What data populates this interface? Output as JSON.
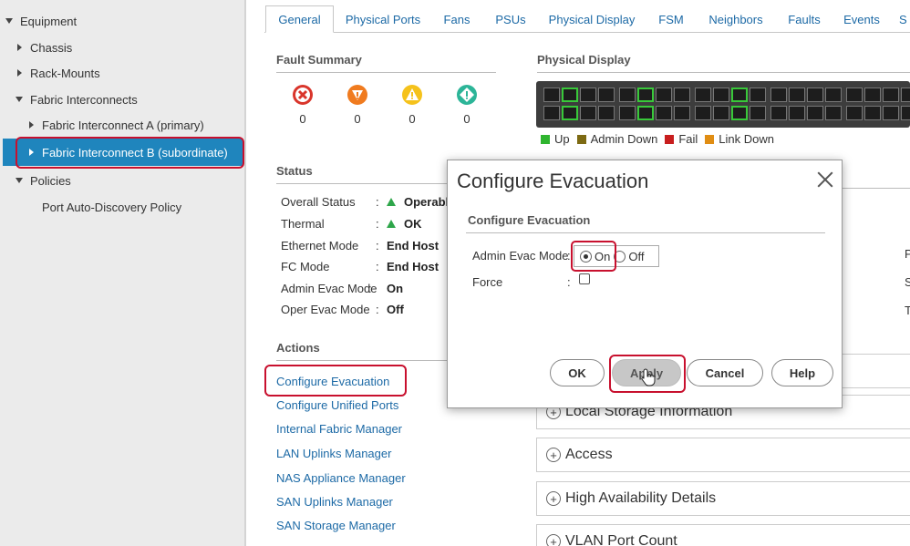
{
  "sidebar": {
    "items": [
      {
        "label": "Equipment",
        "level": 0,
        "expander": "down"
      },
      {
        "label": "Chassis",
        "level": 1,
        "expander": "right"
      },
      {
        "label": "Rack-Mounts",
        "level": 1,
        "expander": "right"
      },
      {
        "label": "Fabric Interconnects",
        "level": 1,
        "expander": "down"
      },
      {
        "label": "Fabric Interconnect A (primary)",
        "level": 2,
        "expander": "right"
      },
      {
        "label": "Fabric Interconnect B (subordinate)",
        "level": 2,
        "expander": "right",
        "selected": true
      },
      {
        "label": "Policies",
        "level": 1,
        "expander": "down"
      },
      {
        "label": "Port Auto-Discovery Policy",
        "level": 2,
        "expander": "none"
      }
    ]
  },
  "tabs": [
    "General",
    "Physical Ports",
    "Fans",
    "PSUs",
    "Physical Display",
    "FSM",
    "Neighbors",
    "Faults",
    "Events",
    "S"
  ],
  "active_tab": "General",
  "fault_summary": {
    "title": "Fault Summary",
    "items": [
      {
        "icon": "critical-fault-icon",
        "count": "0",
        "color": "#d9352b"
      },
      {
        "icon": "major-fault-icon",
        "count": "0",
        "color": "#f07b1f"
      },
      {
        "icon": "minor-fault-icon",
        "count": "0",
        "color": "#f5c21b"
      },
      {
        "icon": "warning-fault-icon",
        "count": "0",
        "color": "#2cb598"
      }
    ]
  },
  "status": {
    "title": "Status",
    "rows": [
      {
        "label": "Overall Status",
        "value": "Operable",
        "icon": "up-arrow-icon"
      },
      {
        "label": "Thermal",
        "value": "OK",
        "icon": "up-arrow-icon"
      },
      {
        "label": "Ethernet Mode",
        "value": "End Host"
      },
      {
        "label": "FC Mode",
        "value": "End Host"
      },
      {
        "label": "Admin Evac Mode",
        "value": "On"
      },
      {
        "label": "Oper Evac Mode",
        "value": "Off"
      }
    ]
  },
  "actions": {
    "title": "Actions",
    "links": [
      "Configure Evacuation",
      "Configure Unified Ports",
      "Internal Fabric Manager",
      "LAN Uplinks Manager",
      "NAS Appliance Manager",
      "SAN Uplinks Manager",
      "SAN Storage Manager"
    ]
  },
  "physical_display": {
    "title": "Physical Display",
    "legend": [
      {
        "label": "Up",
        "color": "#2fb52f"
      },
      {
        "label": "Admin Down",
        "color": "#7d6a13"
      },
      {
        "label": "Fail",
        "color": "#c81e1e"
      },
      {
        "label": "Link Down",
        "color": "#e08d13"
      }
    ]
  },
  "panels": [
    "Local Storage Information",
    "Access",
    "High Availability Details",
    "VLAN Port Count"
  ],
  "right_letters": [
    "P",
    "S",
    "T"
  ],
  "modal": {
    "title": "Configure Evacuation",
    "section": "Configure Evacuation",
    "admin_evac_label": "Admin Evac Mode",
    "colon": ":",
    "options": [
      "On",
      "Off"
    ],
    "selected": "On",
    "force_label": "Force",
    "force_checked": false,
    "buttons": [
      "OK",
      "Apply",
      "Cancel",
      "Help"
    ]
  },
  "colors": {
    "accent": "#1f85bd",
    "link": "#1d6aa6",
    "highlight_outline": "#c8102e"
  }
}
